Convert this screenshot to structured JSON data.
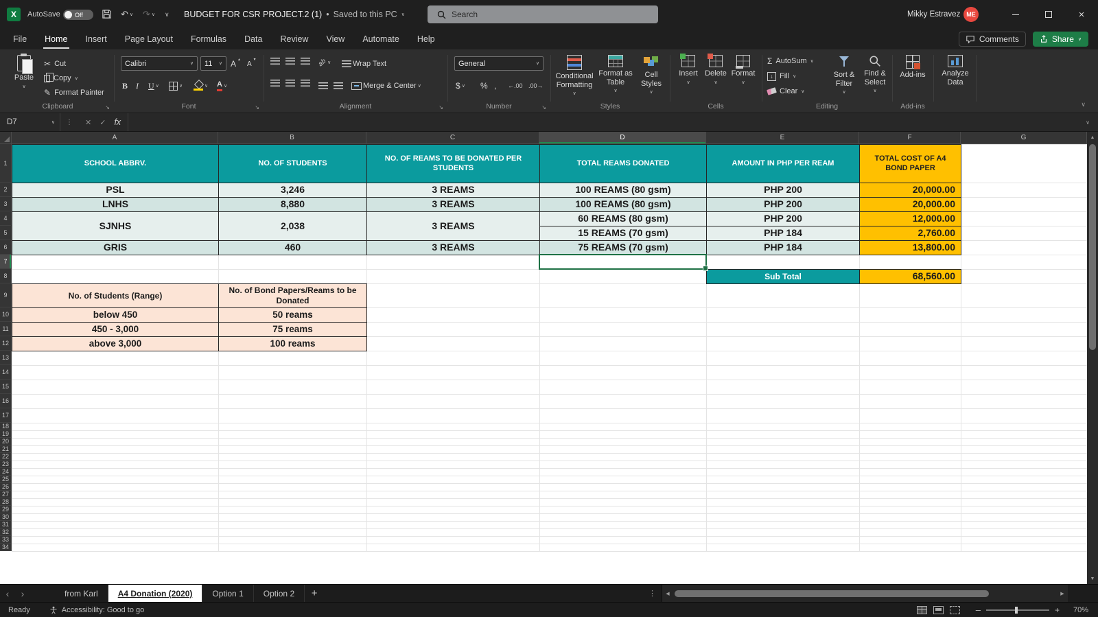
{
  "title_bar": {
    "excel_logo": "X",
    "autosave_label": "AutoSave",
    "autosave_state": "Off",
    "document_title": "BUDGET FOR CSR PROJECT.2 (1)",
    "title_separator": "•",
    "save_status": "Saved to this PC",
    "search_placeholder": "Search",
    "user_name": "Mikky Estravez",
    "user_initials": "ME"
  },
  "menu": {
    "tabs": [
      "File",
      "Home",
      "Insert",
      "Page Layout",
      "Formulas",
      "Data",
      "Review",
      "View",
      "Automate",
      "Help"
    ],
    "active_tab": "Home",
    "comments_label": "Comments",
    "share_label": "Share"
  },
  "ribbon": {
    "clipboard": {
      "label": "Clipboard",
      "paste": "Paste",
      "cut": "Cut",
      "copy": "Copy",
      "format_painter": "Format Painter"
    },
    "font": {
      "label": "Font",
      "font_name": "Calibri",
      "font_size": "11"
    },
    "alignment": {
      "label": "Alignment",
      "wrap_text": "Wrap Text",
      "merge_center": "Merge & Center"
    },
    "number": {
      "label": "Number",
      "format": "General"
    },
    "styles": {
      "label": "Styles",
      "conditional_formatting": "Conditional Formatting",
      "format_as_table": "Format as Table",
      "cell_styles": "Cell Styles"
    },
    "cells": {
      "label": "Cells",
      "insert": "Insert",
      "delete": "Delete",
      "format": "Format"
    },
    "editing": {
      "label": "Editing",
      "autosum": "AutoSum",
      "fill": "Fill",
      "clear": "Clear",
      "sort_filter": "Sort & Filter",
      "find_select": "Find & Select"
    },
    "addins": {
      "label": "Add-ins",
      "button": "Add-ins"
    },
    "analyze": {
      "button": "Analyze Data"
    }
  },
  "formula_bar": {
    "name_box": "D7",
    "fx_label": "fx"
  },
  "sheet": {
    "columns": [
      "A",
      "B",
      "C",
      "D",
      "E",
      "F",
      "G"
    ],
    "row_count": 34,
    "selected_cell": "D7",
    "colors": {
      "header_teal": "#0b9b9e",
      "accent_yellow": "#ffc000",
      "band_light": "#e6efed",
      "band_dark": "#d2e4e1",
      "peach": "#fce4d6",
      "selection_green": "#1e7145"
    },
    "main_table": {
      "headers": [
        "SCHOOL ABBRV.",
        "NO. OF STUDENTS",
        "NO. OF REAMS TO BE DONATED PER STUDENTS",
        "TOTAL REAMS DONATED",
        "AMOUNT IN PHP PER REAM",
        "TOTAL COST OF A4 BOND PAPER"
      ],
      "rows": [
        {
          "school": "PSL",
          "students": "3,246",
          "reams_per": "3 REAMS",
          "total_reams": "100 REAMS (80 gsm)",
          "amount": "PHP 200",
          "total_cost": "20,000.00"
        },
        {
          "school": "LNHS",
          "students": "8,880",
          "reams_per": "3 REAMS",
          "total_reams": "100 REAMS (80 gsm)",
          "amount": "PHP 200",
          "total_cost": "20,000.00"
        },
        {
          "school": "SJNHS",
          "students": "2,038",
          "reams_per": "3 REAMS",
          "total_reams": "60 REAMS (80 gsm)",
          "amount": "PHP 200",
          "total_cost": "12,000.00"
        },
        {
          "school": "",
          "students": "",
          "reams_per": "",
          "total_reams": "15 REAMS (70 gsm)",
          "amount": "PHP 184",
          "total_cost": "2,760.00"
        },
        {
          "school": "GRIS",
          "students": "460",
          "reams_per": "3 REAMS",
          "total_reams": "75 REAMS (70 gsm)",
          "amount": "PHP 184",
          "total_cost": "13,800.00"
        }
      ],
      "subtotal_label": "Sub Total",
      "subtotal_value": "68,560.00"
    },
    "reference_table": {
      "headers": [
        "No. of Students (Range)",
        "No. of Bond Papers/Reams to be Donated"
      ],
      "rows": [
        {
          "range": "below 450",
          "reams": "50 reams"
        },
        {
          "range": "450 - 3,000",
          "reams": "75 reams"
        },
        {
          "range": "above 3,000",
          "reams": "100 reams"
        }
      ]
    }
  },
  "sheet_tabs": {
    "tabs": [
      "from Karl",
      "A4 Donation (2020)",
      "Option 1",
      "Option 2"
    ],
    "active_tab": "A4 Donation (2020)"
  },
  "status_bar": {
    "ready_label": "Ready",
    "accessibility_label": "Accessibility: Good to go",
    "zoom_level": "70%"
  },
  "icons": {
    "chevron_down": "∨",
    "chevron_left": "‹",
    "chevron_right": "›",
    "undo": "↶",
    "redo": "↷",
    "scissors": "✂",
    "brush": "✎",
    "bold": "B",
    "italic": "I",
    "underline": "U",
    "sigma": "Σ",
    "dollar": "$",
    "percent": "%",
    "comma": ",",
    "letter_a": "A",
    "ab": "ab",
    "arrow_down": "↓",
    "increase_decimal": "←.00",
    "decrease_decimal": ".00→",
    "cancel": "✕",
    "confirm": "✓",
    "ellipsis_v": "⋮",
    "tri_left": "◀",
    "tri_right": "▶",
    "tri_up": "▲",
    "tri_down": "▼",
    "plus": "+",
    "minus": "–",
    "window_close": "×",
    "launcher": "↘"
  }
}
